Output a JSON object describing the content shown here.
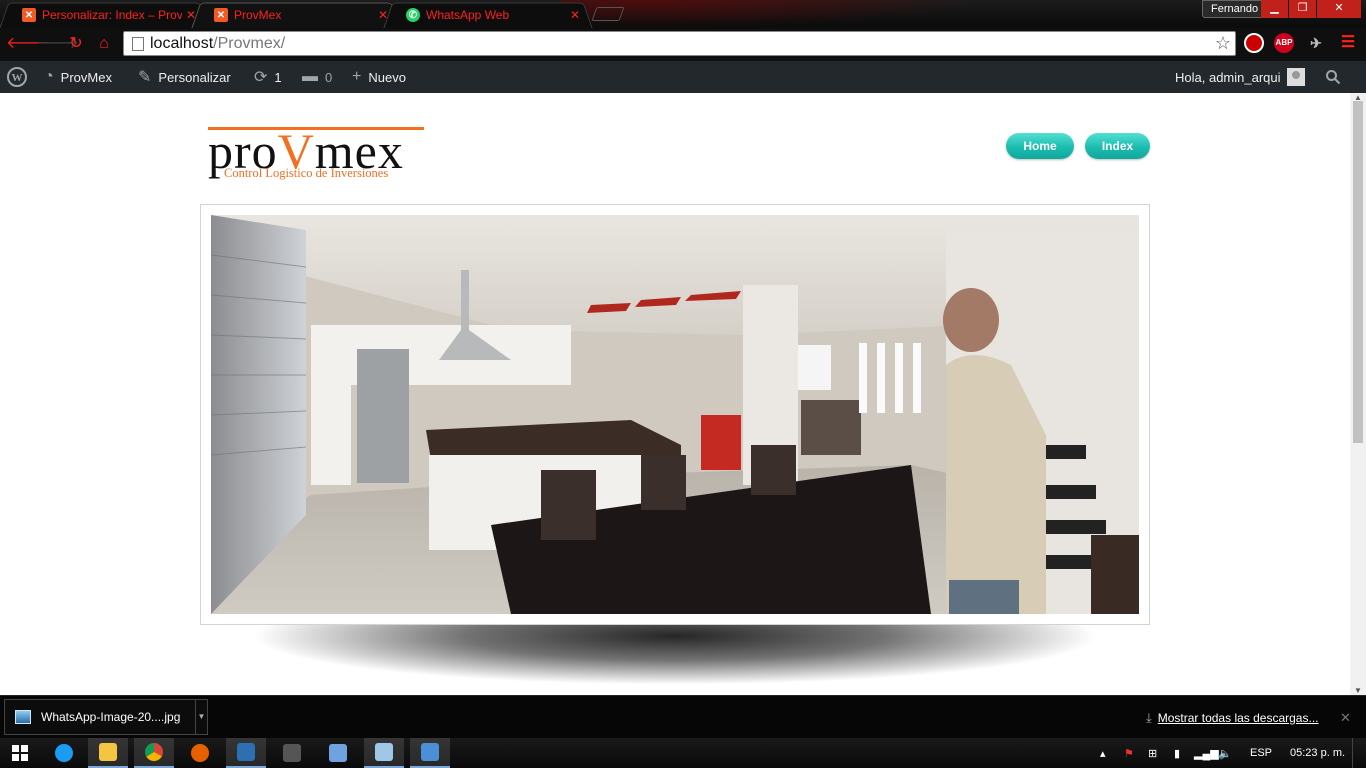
{
  "browser": {
    "tabs": [
      {
        "title": "Personalizar: Index – Prov",
        "favicon": "xampp-icon",
        "active": false
      },
      {
        "title": "ProvMex",
        "favicon": "xampp-icon",
        "active": true
      },
      {
        "title": "WhatsApp Web",
        "favicon": "whatsapp-icon",
        "active": false
      }
    ],
    "profile_name": "Fernando",
    "url_host": "localhost",
    "url_path": "/Provmex/",
    "extensions": [
      "ABP"
    ],
    "accent_color": "#ff2020"
  },
  "adminbar": {
    "site_name": "ProvMex",
    "customize": "Personalizar",
    "updates_count": "1",
    "comments_count": "0",
    "new_label": "Nuevo",
    "greeting": "Hola, admin_arqui"
  },
  "site": {
    "logo_word_left": "pro",
    "logo_word_v": "V",
    "logo_word_right": "mex",
    "logo_tagline": "Control Logistico de Inversiones",
    "nav": [
      {
        "label": "Home"
      },
      {
        "label": "Index"
      }
    ],
    "accent_color": "#1cbcb0",
    "brand_color": "#f36f21"
  },
  "downloads": {
    "file_name": "WhatsApp-Image-20....jpg",
    "show_all": "Mostrar todas las descargas..."
  },
  "taskbar": {
    "language": "ESP",
    "clock": "05:23 p. m."
  }
}
